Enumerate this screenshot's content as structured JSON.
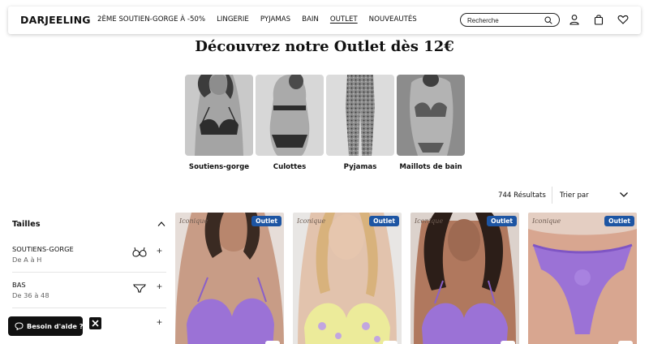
{
  "header": {
    "logo": "DARJEELING",
    "nav": [
      "2ÈME SOUTIEN-GORGE À -50%",
      "LINGERIE",
      "PYJAMAS",
      "BAIN",
      "OUTLET",
      "NOUVEAUTÉS"
    ],
    "active_nav": "OUTLET",
    "search_placeholder": "Recherche",
    "icons": [
      "search-icon",
      "account-icon",
      "bag-icon",
      "heart-icon"
    ]
  },
  "page": {
    "title": "Découvrez notre Outlet dès 12€"
  },
  "categories": [
    {
      "label": "Soutiens-gorge"
    },
    {
      "label": "Culottes"
    },
    {
      "label": "Pyjamas"
    },
    {
      "label": "Maillots de bain"
    }
  ],
  "results": {
    "count": "744 Résultats",
    "sort_label": "Trier par"
  },
  "filters": {
    "title": "Tailles",
    "items": [
      {
        "name": "SOUTIENS-GORGE",
        "sub": "De A à H",
        "icon": "bra-icon"
      },
      {
        "name": "BAS",
        "sub": "De 36 à 48",
        "icon": "panty-icon"
      },
      {
        "name": "",
        "sub": "",
        "icon": ""
      }
    ]
  },
  "help": {
    "label": "Besoin d'aide ?"
  },
  "products": [
    {
      "badge": "Outlet",
      "brand": "Iconique"
    },
    {
      "badge": "Outlet",
      "brand": "Iconique"
    },
    {
      "badge": "Outlet",
      "brand": "Iconique"
    },
    {
      "badge": "Outlet",
      "brand": "Iconique"
    }
  ],
  "colors": {
    "badge": "#1d55a3",
    "lavender": "#9b72d6",
    "black": "#111111"
  }
}
